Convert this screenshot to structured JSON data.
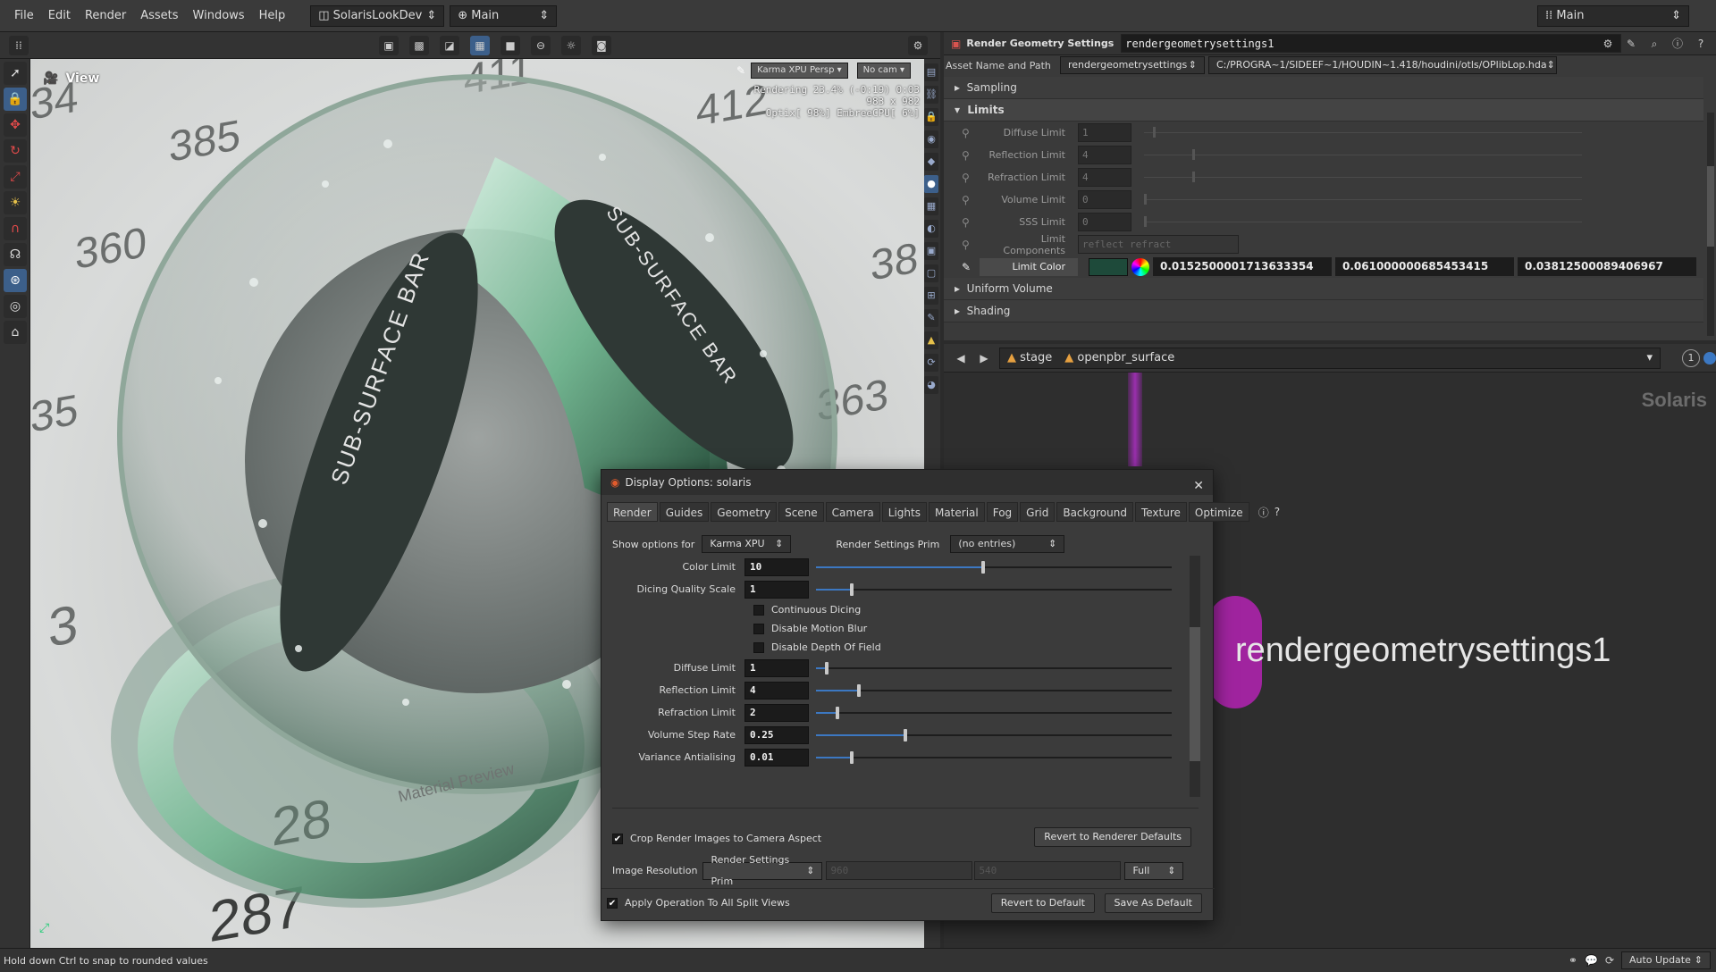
{
  "menubar": {
    "items": [
      "File",
      "Edit",
      "Render",
      "Assets",
      "Windows",
      "Help"
    ],
    "desktop": "SolarisLookDev",
    "context": "Main",
    "right_context": "Main"
  },
  "viewport": {
    "label": "View",
    "renderer": "Karma XPU",
    "camera_mode": "Persp",
    "camera": "No cam",
    "status_line1": "Rendering  23.4% (-0:19)  0:03",
    "status_line2": "983 x 982",
    "status_line3": "Optix[ 98%] EmbreeCPU[  6%]",
    "sphere_text_1": "SUB-SURFACE BAR",
    "sphere_text_2": "SUB-SURFACE BAR",
    "ground_text": "Material Preview",
    "ground_numbers": [
      "411",
      "412",
      "385",
      "360",
      "38",
      "363",
      "35",
      "34",
      "3",
      "28",
      "287"
    ]
  },
  "params": {
    "node_type": "Render Geometry Settings",
    "node_name": "rendergeometrysettings1",
    "asset_label": "Asset Name and Path",
    "asset_name": "rendergeometrysettings",
    "asset_path": "C:/PROGRA~1/SIDEEF~1/HOUDIN~1.418/houdini/otls/OPlibLop.hda",
    "sections": {
      "sampling": "Sampling",
      "limits": "Limits",
      "uniform_volume": "Uniform Volume",
      "shading": "Shading"
    },
    "limits": [
      {
        "label": "Diffuse Limit",
        "value": "1",
        "slider": 0.02
      },
      {
        "label": "Reflection Limit",
        "value": "4",
        "slider": 0.11
      },
      {
        "label": "Refraction Limit",
        "value": "4",
        "slider": 0.11
      },
      {
        "label": "Volume Limit",
        "value": "0",
        "slider": 0.0
      },
      {
        "label": "SSS Limit",
        "value": "0",
        "slider": 0.0
      }
    ],
    "limit_components_label": "Limit Components",
    "limit_components_value": "reflect refract",
    "limit_color_label": "Limit Color",
    "limit_color_swatch": "#1e4a3a",
    "limit_color": [
      "0.0152500001713633354",
      "0.061000000685453415",
      "0.03812500089406967"
    ]
  },
  "network": {
    "path": [
      "stage",
      "openpbr_surface"
    ],
    "watermark": "Solaris",
    "node_label": "rendergeometrysettings1",
    "page_indicator": "1"
  },
  "dialog": {
    "title": "Display Options:  solaris",
    "tabs": [
      "Render",
      "Guides",
      "Geometry",
      "Scene",
      "Camera",
      "Lights",
      "Material",
      "Fog",
      "Grid",
      "Background",
      "Texture",
      "Optimize"
    ],
    "show_options_label": "Show options for",
    "show_options_value": "Karma XPU",
    "render_settings_prim_label": "Render Settings Prim",
    "render_settings_prim_value": "(no entries)",
    "fields": [
      {
        "label": "Color Limit",
        "value": "10",
        "fill": 0.47
      },
      {
        "label": "Dicing Quality Scale",
        "value": "1",
        "fill": 0.1
      }
    ],
    "checks": [
      "Continuous Dicing",
      "Disable Motion Blur",
      "Disable Depth Of Field"
    ],
    "fields2": [
      {
        "label": "Diffuse Limit",
        "value": "1",
        "fill": 0.03
      },
      {
        "label": "Reflection Limit",
        "value": "4",
        "fill": 0.12
      },
      {
        "label": "Refraction Limit",
        "value": "2",
        "fill": 0.06
      },
      {
        "label": "Volume Step Rate",
        "value": "0.25",
        "fill": 0.25
      },
      {
        "label": "Variance Antialising",
        "value": "0.01",
        "fill": 0.1
      }
    ],
    "crop_label": "Crop Render Images to Camera Aspect",
    "revert_renderer": "Revert to Renderer Defaults",
    "image_res_label": "Image Resolution",
    "image_res_value": "Render Settings Prim",
    "res_w": "960",
    "res_h": "540",
    "res_mode": "Full",
    "apply_all_label": "Apply Operation To All Split Views",
    "revert_default": "Revert to Default",
    "save_default": "Save As Default"
  },
  "status": {
    "hint": "Hold down Ctrl to snap to rounded values",
    "auto_update": "Auto Update"
  }
}
